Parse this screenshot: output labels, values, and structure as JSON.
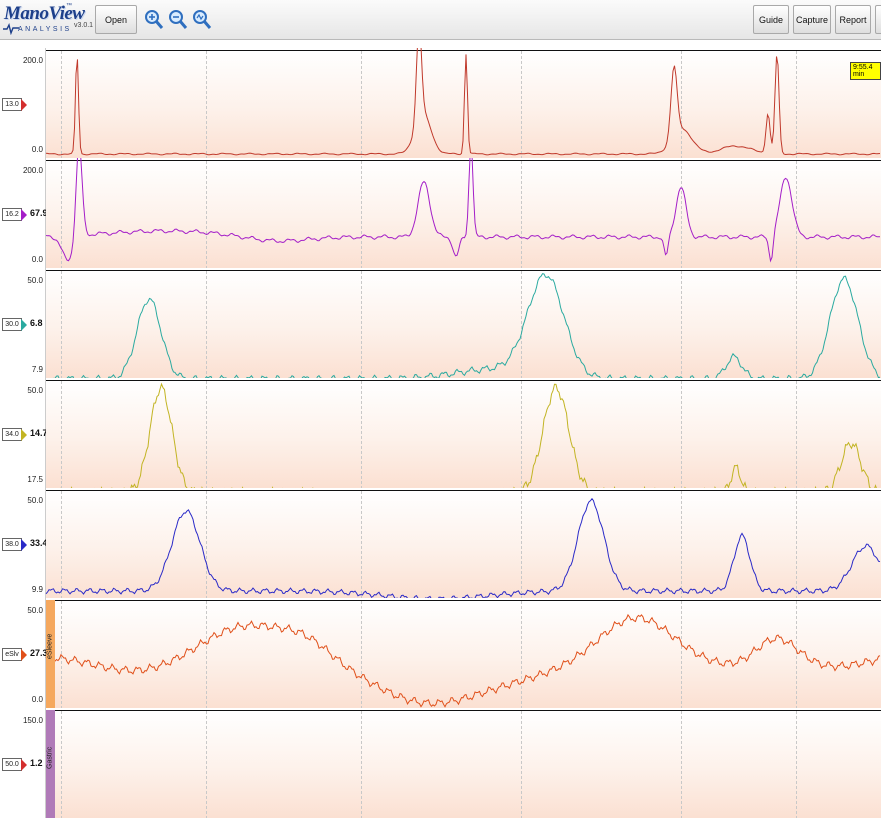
{
  "app": {
    "brand": "ManoView",
    "brand_sub": "ANALYSIS",
    "trademark": "™",
    "version": "v3.0.1"
  },
  "toolbar": {
    "open_label": "Open",
    "guide_label": "Guide",
    "capture_label": "Capture",
    "report_label": "Report"
  },
  "colors": {
    "panel1": "#c0392b",
    "panel2": "#a41ec8",
    "panel3": "#2aaaa0",
    "panel4": "#c2b423",
    "panel5": "#2a2ac8",
    "panel6": "#e0501a",
    "sleeve_bg": "#f5a85e",
    "gastric_bg": "#b07ab8"
  },
  "time_marker": "9:55.4 min",
  "panels": [
    {
      "id": "p1",
      "max": "200.0",
      "min": "0.0",
      "tag": "13.0",
      "value": "",
      "tip": "#d32f2f",
      "side_label": ""
    },
    {
      "id": "p2",
      "max": "200.0",
      "min": "0.0",
      "tag": "16.2",
      "value": "67.9",
      "tip": "#a41ec8",
      "side_label": ""
    },
    {
      "id": "p3",
      "max": "50.0",
      "min": "7.9",
      "tag": "30.0",
      "value": "6.8",
      "tip": "#2aaaa0",
      "side_label": ""
    },
    {
      "id": "p4",
      "max": "50.0",
      "min": "17.5",
      "tag": "34.0",
      "value": "14.7",
      "tip": "#c2b423",
      "side_label": ""
    },
    {
      "id": "p5",
      "max": "50.0",
      "min": "9.9",
      "tag": "38.0",
      "value": "33.4",
      "tip": "#2a2ac8",
      "side_label": ""
    },
    {
      "id": "p6",
      "max": "50.0",
      "min": "0.0",
      "tag": "eSlv",
      "value": "27.3",
      "tip": "#e0501a",
      "side_label": "eSleeve"
    },
    {
      "id": "p7",
      "max": "150.0",
      "min": "",
      "tag": "50.0",
      "value": "1.2",
      "tip": "#d32f2f",
      "side_label": "Gastric"
    }
  ]
}
